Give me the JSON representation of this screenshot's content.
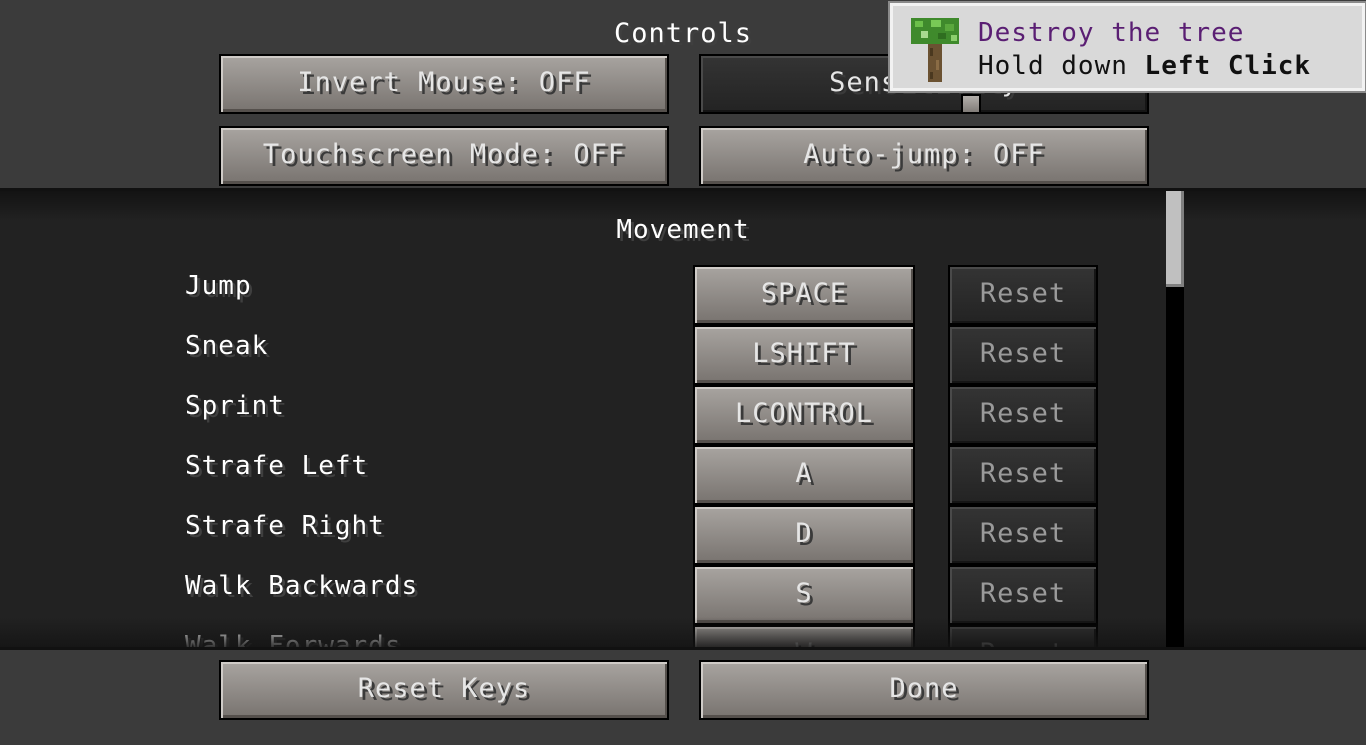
{
  "screen": {
    "title": "Controls"
  },
  "top_buttons": {
    "invert_mouse": "Invert Mouse: OFF",
    "sensitivity": "Sensitivity",
    "touchscreen": "Touchscreen Mode: OFF",
    "auto_jump": "Auto-jump: OFF"
  },
  "movement": {
    "heading": "Movement",
    "rows": [
      {
        "label": "Jump",
        "key": "SPACE",
        "reset": "Reset"
      },
      {
        "label": "Sneak",
        "key": "LSHIFT",
        "reset": "Reset"
      },
      {
        "label": "Sprint",
        "key": "LCONTROL",
        "reset": "Reset"
      },
      {
        "label": "Strafe Left",
        "key": "A",
        "reset": "Reset"
      },
      {
        "label": "Strafe Right",
        "key": "D",
        "reset": "Reset"
      },
      {
        "label": "Walk Backwards",
        "key": "S",
        "reset": "Reset"
      },
      {
        "label": "Walk Forwards",
        "key": "W",
        "reset": "Reset"
      }
    ]
  },
  "bottom_buttons": {
    "reset_keys": "Reset Keys",
    "done": "Done"
  },
  "toast": {
    "icon": "oak-tree-icon",
    "title": "Destroy the tree",
    "desc_prefix": "Hold down",
    "desc_key": "Left Click",
    "title_color": "#5a1e73"
  }
}
